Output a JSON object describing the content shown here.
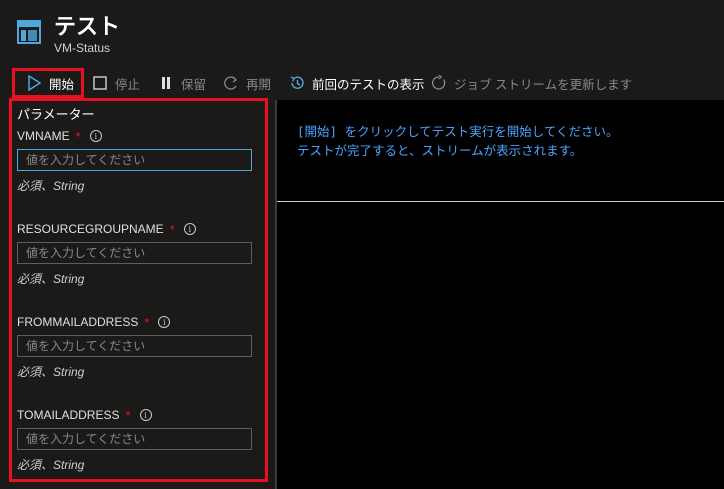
{
  "header": {
    "title": "テスト",
    "subtitle": "VM-Status",
    "icon": "runbook-window-icon"
  },
  "toolbar": {
    "start_label": "開始",
    "stop_label": "停止",
    "pause_label": "保留",
    "resume_label": "再開",
    "previous_tests_label": "前回のテストの表示",
    "refresh_label": "ジョブ ストリームを更新します"
  },
  "params_panel": {
    "title": "パラメーター",
    "items": [
      {
        "name": "VMNAME",
        "required": "*",
        "placeholder": "値を入力してください",
        "hint": "必須、String"
      },
      {
        "name": "RESOURCEGROUPNAME",
        "required": "*",
        "placeholder": "値を入力してください",
        "hint": "必須、String"
      },
      {
        "name": "FROMMAILADDRESS",
        "required": "*",
        "placeholder": "値を入力してください",
        "hint": "必須、String"
      },
      {
        "name": "TOMAILADDRESS",
        "required": "*",
        "placeholder": "値を入力してください",
        "hint": "必須、String"
      }
    ]
  },
  "output": {
    "line1": "[開始] をクリックしてテスト実行を開始してください。",
    "line2": "テストが完了すると、ストリームが表示されます。"
  },
  "colors": {
    "accent_red": "#e81123",
    "link_blue": "#4aa3ff",
    "background": "#1b1a19",
    "output_background": "#000000"
  }
}
